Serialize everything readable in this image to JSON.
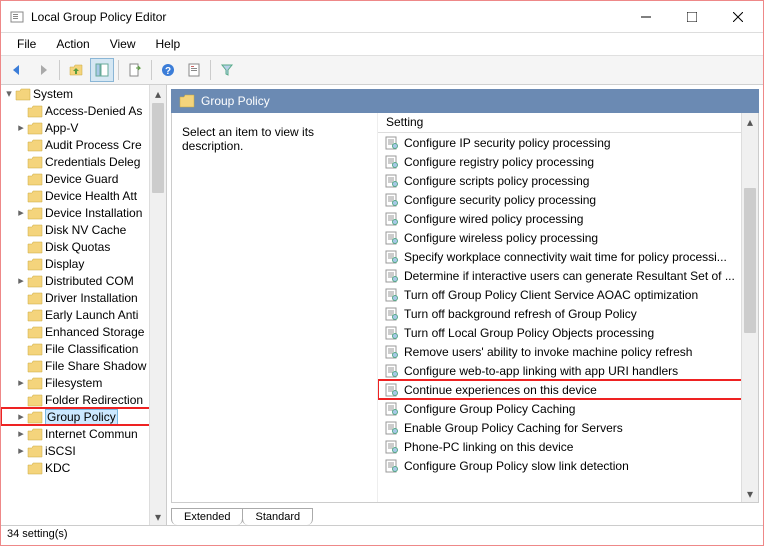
{
  "window": {
    "title": "Local Group Policy Editor"
  },
  "menubar": [
    "File",
    "Action",
    "View",
    "Help"
  ],
  "tree": {
    "root": "System",
    "items": [
      {
        "label": "Access-Denied As",
        "exp": false
      },
      {
        "label": "App-V",
        "exp": true
      },
      {
        "label": "Audit Process Cre",
        "exp": false
      },
      {
        "label": "Credentials Deleg",
        "exp": false
      },
      {
        "label": "Device Guard",
        "exp": false
      },
      {
        "label": "Device Health Att",
        "exp": false
      },
      {
        "label": "Device Installation",
        "exp": true
      },
      {
        "label": "Disk NV Cache",
        "exp": false
      },
      {
        "label": "Disk Quotas",
        "exp": false
      },
      {
        "label": "Display",
        "exp": false
      },
      {
        "label": "Distributed COM",
        "exp": true
      },
      {
        "label": "Driver Installation",
        "exp": false
      },
      {
        "label": "Early Launch Anti",
        "exp": false
      },
      {
        "label": "Enhanced Storage",
        "exp": false
      },
      {
        "label": "File Classification",
        "exp": false
      },
      {
        "label": "File Share Shadow",
        "exp": false
      },
      {
        "label": "Filesystem",
        "exp": true
      },
      {
        "label": "Folder Redirection",
        "exp": false
      },
      {
        "label": "Group Policy",
        "exp": true,
        "selected": true,
        "highlighted": true
      },
      {
        "label": "Internet Commun",
        "exp": true
      },
      {
        "label": "iSCSI",
        "exp": true
      },
      {
        "label": "KDC",
        "exp": false
      }
    ]
  },
  "rightHeader": "Group Policy",
  "description": "Select an item to view its description.",
  "listHeader": "Setting",
  "settings": [
    {
      "label": "Configure IP security policy processing"
    },
    {
      "label": "Configure registry policy processing"
    },
    {
      "label": "Configure scripts policy processing"
    },
    {
      "label": "Configure security policy processing"
    },
    {
      "label": "Configure wired policy processing"
    },
    {
      "label": "Configure wireless policy processing"
    },
    {
      "label": "Specify workplace connectivity wait time for policy processi..."
    },
    {
      "label": "Determine if interactive users can generate Resultant Set of ..."
    },
    {
      "label": "Turn off Group Policy Client Service AOAC optimization"
    },
    {
      "label": "Turn off background refresh of Group Policy"
    },
    {
      "label": "Turn off Local Group Policy Objects processing"
    },
    {
      "label": "Remove users' ability to invoke machine policy refresh"
    },
    {
      "label": "Configure web-to-app linking with app URI handlers"
    },
    {
      "label": "Continue experiences on this device",
      "highlighted": true
    },
    {
      "label": "Configure Group Policy Caching"
    },
    {
      "label": "Enable Group Policy Caching for Servers"
    },
    {
      "label": "Phone-PC linking on this device"
    },
    {
      "label": "Configure Group Policy slow link detection"
    }
  ],
  "tabs": {
    "extended": "Extended",
    "standard": "Standard"
  },
  "status": "34 setting(s)"
}
